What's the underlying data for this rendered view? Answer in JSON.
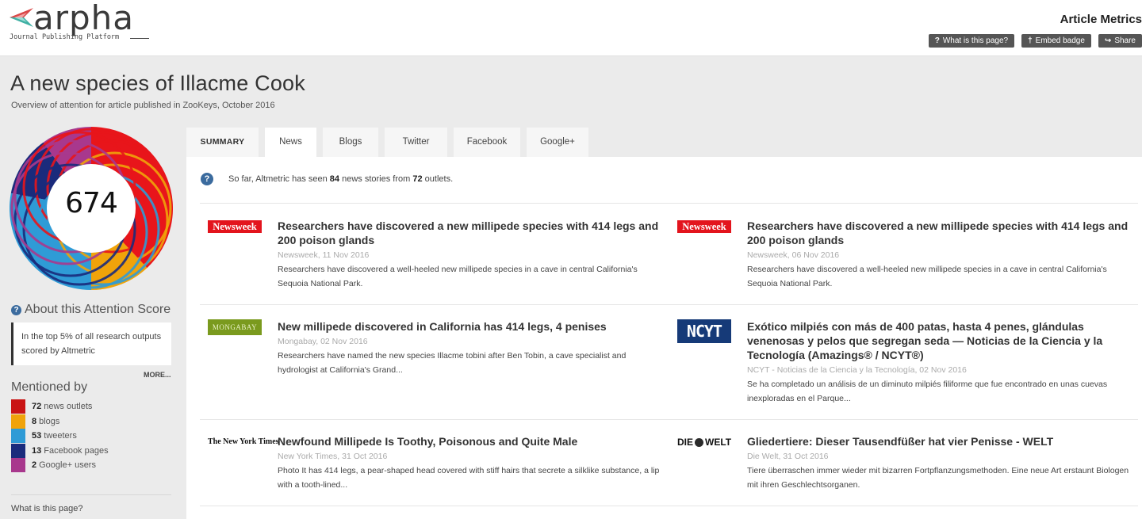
{
  "header": {
    "logo_word": "arpha",
    "logo_sub": "Journal Publishing Platform",
    "title": "Article Metrics",
    "buttons": [
      {
        "icon": "question-icon",
        "glyph": "?",
        "label": "What is this page?"
      },
      {
        "icon": "pin-icon",
        "glyph": "†",
        "label": "Embed badge"
      },
      {
        "icon": "share-icon",
        "glyph": "↪",
        "label": "Share"
      }
    ]
  },
  "article": {
    "title": "A new species of Illacme Cook",
    "subtitle": "Overview of attention for article published in ZooKeys, October 2016"
  },
  "score": {
    "value": "674",
    "colors": [
      "#e8151b",
      "#f0a30a",
      "#2f9bd6",
      "#1a2b7c",
      "#a8388d"
    ]
  },
  "about": {
    "title": "About this Attention Score",
    "box_text": "In the top 5% of all research outputs scored by Altmetric",
    "more": "MORE..."
  },
  "mentioned": {
    "title": "Mentioned by",
    "items": [
      {
        "count": "72",
        "label": "news outlets",
        "color": "#c91414"
      },
      {
        "count": "8",
        "label": "blogs",
        "color": "#f0a30a"
      },
      {
        "count": "53",
        "label": "tweeters",
        "color": "#2f9bd6"
      },
      {
        "count": "13",
        "label": "Facebook pages",
        "color": "#1a2b7c"
      },
      {
        "count": "2",
        "label": "Google+ users",
        "color": "#a8388d"
      }
    ]
  },
  "footer_link": "What is this page?",
  "tabs": [
    "SUMMARY",
    "News",
    "Blogs",
    "Twitter",
    "Facebook",
    "Google+"
  ],
  "info": {
    "pre": "So far, Altmetric has seen ",
    "stories": "84",
    "mid": " news stories from ",
    "outlets": "72",
    "post": " outlets."
  },
  "stories": [
    {
      "logo": "Newsweek",
      "title": "Researchers have discovered a new millipede species with 414 legs and 200 poison glands",
      "meta": "Newsweek, 11 Nov 2016",
      "excerpt": "Researchers have discovered a well-heeled new millipede species in a cave in central California's Sequoia National Park."
    },
    {
      "logo": "Newsweek",
      "title": "Researchers have discovered a new millipede species with 414 legs and 200 poison glands",
      "meta": "Newsweek, 06 Nov 2016",
      "excerpt": "Researchers have discovered a well-heeled new millipede species in a cave in central California's Sequoia National Park."
    },
    {
      "logo": "MONGABAY",
      "title": "New millipede discovered in California has 414 legs, 4 penises",
      "meta": "Mongabay, 02 Nov 2016",
      "excerpt": "Researchers have named the new species Illacme tobini after Ben Tobin, a cave specialist and hydrologist at California's Grand..."
    },
    {
      "logo": "NCYT",
      "title": "Exótico milpiés con más de 400 patas, hasta 4 penes, glándulas venenosas y pelos que segregan seda — Noticias de la Ciencia y la Tecnología (Amazings® / NCYT®)",
      "meta": "NCYT - Noticias de la Ciencia y la Tecnología, 02 Nov 2016",
      "excerpt": "Se ha completado un análisis de un diminuto milpiés filiforme que fue encontrado en unas cuevas inexploradas en el Parque..."
    },
    {
      "logo": "The New York Times",
      "title": "Newfound Millipede Is Toothy, Poisonous and Quite Male",
      "meta": "New York Times, 31 Oct 2016",
      "excerpt": "Photo It has 414 legs, a pear-shaped head covered with stiff hairs that secrete a silklike substance, a lip with a tooth-lined..."
    },
    {
      "logo_left": "DIE",
      "logo_right": "WELT",
      "title": "Gliedertiere: Dieser Tausendfüßer hat vier Penisse - WELT",
      "meta": "Die Welt, 31 Oct 2016",
      "excerpt": "Tiere überraschen immer wieder mit bizarren Fortpflanzungsmethoden. Eine neue Art erstaunt Biologen mit ihren Geschlechtsorganen."
    }
  ]
}
